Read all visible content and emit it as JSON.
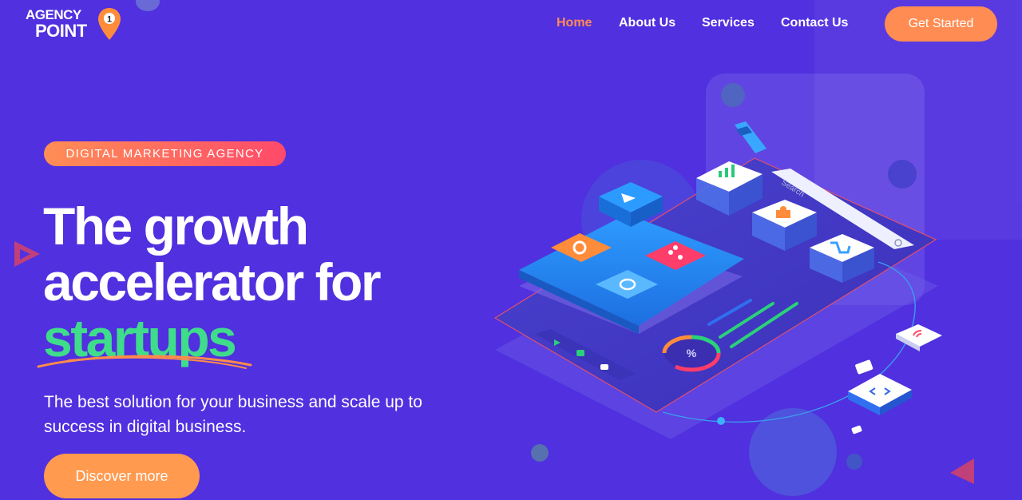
{
  "brand": {
    "line1": "AGENCY",
    "line2": "POINT",
    "pin_number": "1"
  },
  "nav": {
    "items": [
      {
        "label": "Home",
        "active": true
      },
      {
        "label": "About Us",
        "active": false
      },
      {
        "label": "Services",
        "active": false
      },
      {
        "label": "Contact Us",
        "active": false
      }
    ],
    "cta_label": "Get Started"
  },
  "hero": {
    "badge": "DIGITAL MARKETING AGENCY",
    "headline_line1": "The growth",
    "headline_line2": "accelerator for",
    "headline_highlight": "startups",
    "subtext": "The best solution for your business and scale up to success in digital business.",
    "cta_label": "Discover more"
  },
  "illustration": {
    "search_placeholder": "Search",
    "percent_symbol": "%"
  },
  "colors": {
    "background": "#5030df",
    "accent_orange": "#ff8c52",
    "accent_green": "#3fdc8c",
    "accent_pink": "#ff4a6a",
    "nav_active": "#ff8a55"
  }
}
